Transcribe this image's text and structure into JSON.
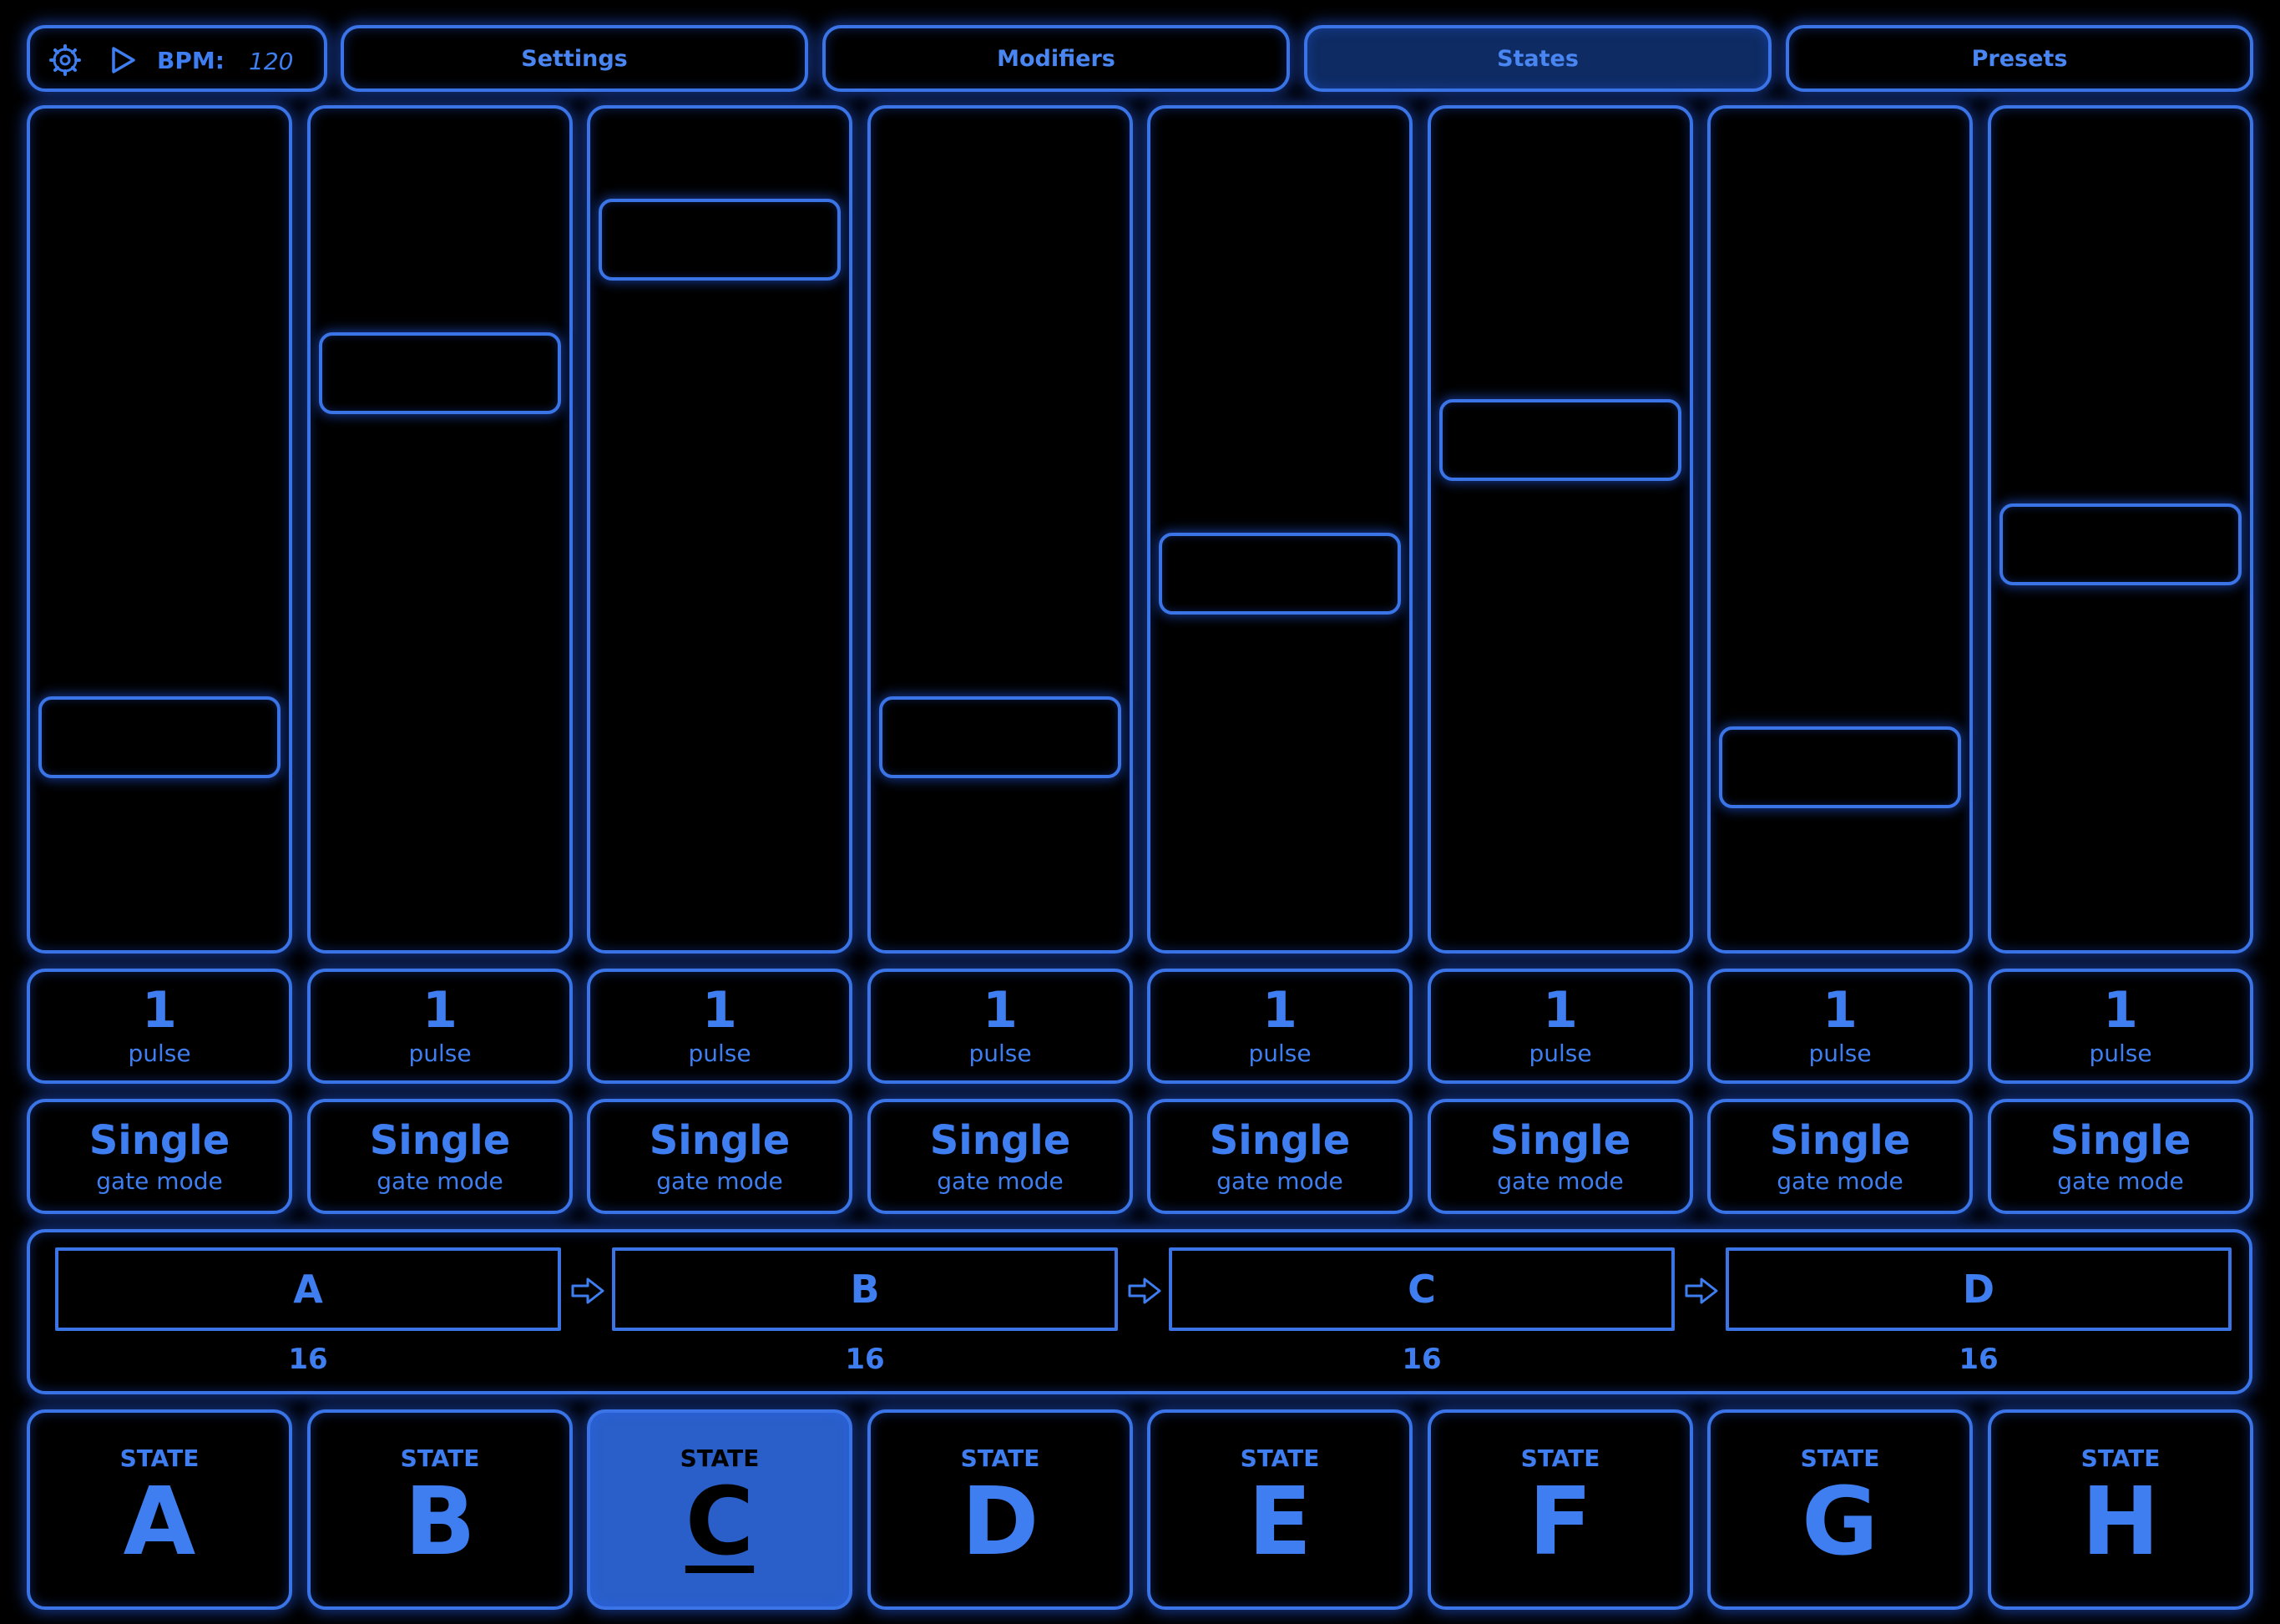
{
  "transport": {
    "bpm_label": "BPM:",
    "bpm_value": "120"
  },
  "tabs": [
    {
      "label": "Settings",
      "active": false
    },
    {
      "label": "Modifiers",
      "active": false
    },
    {
      "label": "States",
      "active": true
    },
    {
      "label": "Presets",
      "active": false
    }
  ],
  "channels": [
    {
      "level": 0.22,
      "pulse_value": "1",
      "pulse_label": "pulse",
      "gate_value": "Single",
      "gate_label": "gate mode"
    },
    {
      "level": 0.71,
      "pulse_value": "1",
      "pulse_label": "pulse",
      "gate_value": "Single",
      "gate_label": "gate mode"
    },
    {
      "level": 0.89,
      "pulse_value": "1",
      "pulse_label": "pulse",
      "gate_value": "Single",
      "gate_label": "gate mode"
    },
    {
      "level": 0.22,
      "pulse_value": "1",
      "pulse_label": "pulse",
      "gate_value": "Single",
      "gate_label": "gate mode"
    },
    {
      "level": 0.44,
      "pulse_value": "1",
      "pulse_label": "pulse",
      "gate_value": "Single",
      "gate_label": "gate mode"
    },
    {
      "level": 0.62,
      "pulse_value": "1",
      "pulse_label": "pulse",
      "gate_value": "Single",
      "gate_label": "gate mode"
    },
    {
      "level": 0.18,
      "pulse_value": "1",
      "pulse_label": "pulse",
      "gate_value": "Single",
      "gate_label": "gate mode"
    },
    {
      "level": 0.48,
      "pulse_value": "1",
      "pulse_label": "pulse",
      "gate_value": "Single",
      "gate_label": "gate mode"
    }
  ],
  "sequence": [
    {
      "name": "A",
      "length": "16"
    },
    {
      "name": "B",
      "length": "16"
    },
    {
      "name": "C",
      "length": "16"
    },
    {
      "name": "D",
      "length": "16"
    }
  ],
  "states": [
    {
      "label": "STATE",
      "letter": "A",
      "active": false
    },
    {
      "label": "STATE",
      "letter": "B",
      "active": false
    },
    {
      "label": "STATE",
      "letter": "C",
      "active": true
    },
    {
      "label": "STATE",
      "letter": "D",
      "active": false
    },
    {
      "label": "STATE",
      "letter": "E",
      "active": false
    },
    {
      "label": "STATE",
      "letter": "F",
      "active": false
    },
    {
      "label": "STATE",
      "letter": "G",
      "active": false
    },
    {
      "label": "STATE",
      "letter": "H",
      "active": false
    }
  ],
  "colors": {
    "accent": "#3f7ef0",
    "active_fill": "#2a5fc9",
    "background": "#000000"
  },
  "icons": {
    "settings": "gear-icon",
    "play": "play-icon",
    "arrow": "arrow-right-icon"
  }
}
